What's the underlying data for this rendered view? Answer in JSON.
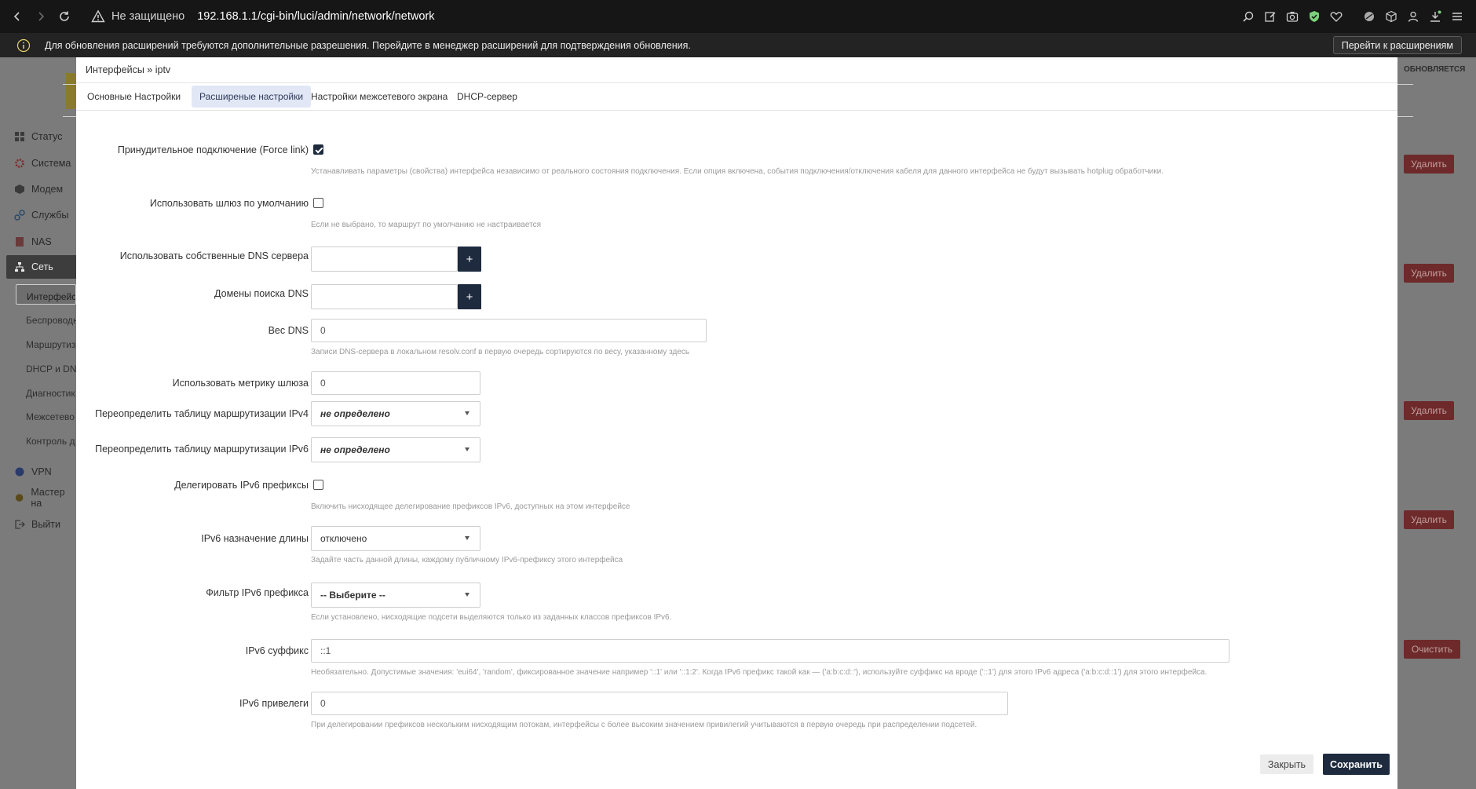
{
  "browser": {
    "security_text": "Не защищено",
    "url": "192.168.1.1/cgi-bin/luci/admin/network/network",
    "toolbar_icons": [
      "zoom-icon",
      "edit-icon",
      "camera-icon",
      "shield-check-icon",
      "heart-icon",
      "pin-icon",
      "box-icon",
      "profile-icon",
      "download-icon",
      "menu-icon"
    ]
  },
  "notice": {
    "text": "Для обновления расширений требуются дополнительные разрешения. Перейдите в менеджер расширений для подтверждения обновления.",
    "button_label": "Перейти к расширениям"
  },
  "background_page": {
    "sidebar": [
      {
        "label": "Статус",
        "icon": "dashboard-icon"
      },
      {
        "label": "Система",
        "icon": "gear-icon"
      },
      {
        "label": "Модем",
        "icon": "modem-icon"
      },
      {
        "label": "Службы",
        "icon": "services-icon"
      },
      {
        "label": "NAS",
        "icon": "nas-icon"
      },
      {
        "label": "Сеть",
        "icon": "network-icon"
      },
      {
        "label": "VPN",
        "icon": "globe-icon"
      },
      {
        "label": "Мастер на",
        "icon": "wizard-icon"
      },
      {
        "label": "Выйти",
        "icon": "logout-icon"
      }
    ],
    "network_submenu": [
      "Интерфейсы",
      "Беспроводн",
      "Маршрутиз",
      "DHCP и DN",
      "Диагностик",
      "Межсетево",
      "Контроль д"
    ],
    "right_text": "ОБНОВЛЯЕТСЯ",
    "delete_label": "Удалить",
    "clear_label": "Очистить"
  },
  "modal": {
    "title": "Интерфейсы » iptv",
    "tabs": [
      "Основные Настройки",
      "Расширеные настройки",
      "Настройки межсетевого экрана",
      "DHCP-сервер"
    ],
    "fields": {
      "force_link": {
        "label": "Принудительное подключение (Force link)",
        "checked": true,
        "description": "Устанавливать параметры (свойства) интерфейса независимо от реального состояния подключения. Если опция включена, события подключения/отключения кабеля для данного интерфейса не будут вызывать hotplug обработчики."
      },
      "default_gw": {
        "label": "Использовать шлюз по умолчанию",
        "checked": false,
        "description": "Если не выбрано, то маршрут по умолчанию не настраивается"
      },
      "dns_servers": {
        "label": "Использовать собственные DNS сервера",
        "value": "",
        "add_label": "+"
      },
      "dns_domains": {
        "label": "Домены поиска DNS",
        "value": "",
        "add_label": "+"
      },
      "dns_weight": {
        "label": "Вес DNS",
        "placeholder": "0",
        "description": "Записи DNS-сервера в локальном resolv.conf в первую очередь сортируются по весу, указанному здесь"
      },
      "gw_metric": {
        "label": "Использовать метрику шлюза",
        "placeholder": "0"
      },
      "ip4table": {
        "label": "Переопределить таблицу маршрутизации IPv4",
        "selected": "не определено"
      },
      "ip6table": {
        "label": "Переопределить таблицу маршрутизации IPv6",
        "selected": "не определено"
      },
      "delegate": {
        "label": "Делегировать IPv6 префиксы",
        "checked": false,
        "description": "Включить нисходящее делегирование префиксов IPv6, доступных на этом интерфейсе"
      },
      "ip6assign": {
        "label": "IPv6 назначение длины",
        "selected": "отключено",
        "description": "Задайте часть данной длины, каждому публичному IPv6-префиксу этого интерфейса"
      },
      "ip6class": {
        "label": "Фильтр IPv6 префикса",
        "selected": "-- Выберите --",
        "description": "Если установлено, нисходящие подсети выделяются только из заданных классов префиксов IPv6."
      },
      "ip6ifaceid": {
        "label": "IPv6 суффикс",
        "placeholder": "::1",
        "description": "Необязательно. Допустимые значения: 'eui64', 'random', фиксированное значение например '::1' или '::1:2'. Когда IPv6 префикс такой как — ('a:b:c:d::'), используйте суффикс на вроде ('::1') для этого IPv6 адреса ('a:b:c:d::1') для этого интерфейса."
      },
      "ip6weight": {
        "label": "IPv6 привелеги",
        "placeholder": "0",
        "description": "При делегировании префиксов нескольким нисходящим потокам, интерфейсы с более высоким значением привилегий учитываются в первую очередь при распределении подсетей."
      }
    },
    "buttons": {
      "close": "Закрыть",
      "save": "Сохранить"
    }
  }
}
